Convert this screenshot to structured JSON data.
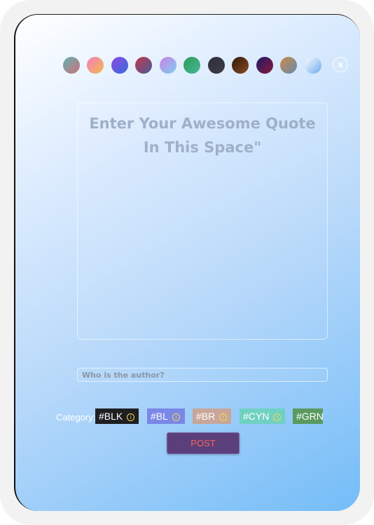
{
  "swatches": [
    {
      "name": "teal-rose",
      "gradient": [
        "#5fb3b3",
        "#d1707a"
      ]
    },
    {
      "name": "pink-orange",
      "gradient": [
        "#f07ec0",
        "#f7b94a"
      ]
    },
    {
      "name": "violet-blue",
      "gradient": [
        "#8a4be0",
        "#3a6bdc"
      ]
    },
    {
      "name": "crimson-blue",
      "gradient": [
        "#c0394a",
        "#4a5a9a"
      ]
    },
    {
      "name": "lilac-cyan",
      "gradient": [
        "#d07fe8",
        "#7ad0f0"
      ]
    },
    {
      "name": "green-teal",
      "gradient": [
        "#2a9a55",
        "#4ab89a"
      ]
    },
    {
      "name": "charcoal",
      "gradient": [
        "#2e2f3a",
        "#3a3c48"
      ]
    },
    {
      "name": "dark-brown",
      "gradient": [
        "#2e1a0e",
        "#8a4a1e"
      ]
    },
    {
      "name": "navy-maroon",
      "gradient": [
        "#1e1a6a",
        "#8a1a3a"
      ]
    },
    {
      "name": "tan-slate",
      "gradient": [
        "#c88a4a",
        "#6a8aa8"
      ]
    },
    {
      "name": "white-blue",
      "gradient": [
        "#ffffff",
        "#6aaaf0"
      ]
    }
  ],
  "close_label": "x",
  "quote": {
    "placeholder_line1": "Enter Your Awesome Quote",
    "placeholder_line2": "In This Space\""
  },
  "author": {
    "placeholder": "Who is the author?",
    "value": ""
  },
  "category": {
    "label": "Category:",
    "tags": [
      {
        "label": "#BLK",
        "bg": "#1f1f22",
        "color": "#ffffff"
      },
      {
        "label": "#BL",
        "bg": "#7a87e6",
        "color": "#ffffff"
      },
      {
        "label": "#BR",
        "bg": "#c9a69a",
        "color": "#ffffff"
      },
      {
        "label": "#CYN",
        "bg": "#6fd1c2",
        "color": "#ffffff"
      },
      {
        "label": "#GRN",
        "bg": "#5a9a5e",
        "color": "#ffffff"
      }
    ],
    "info_symbol": "i"
  },
  "post_label": "POST",
  "colors": {
    "post_bg": "#5a3f7a",
    "post_text": "#f0675e",
    "info_accent": "#f6d64a"
  }
}
